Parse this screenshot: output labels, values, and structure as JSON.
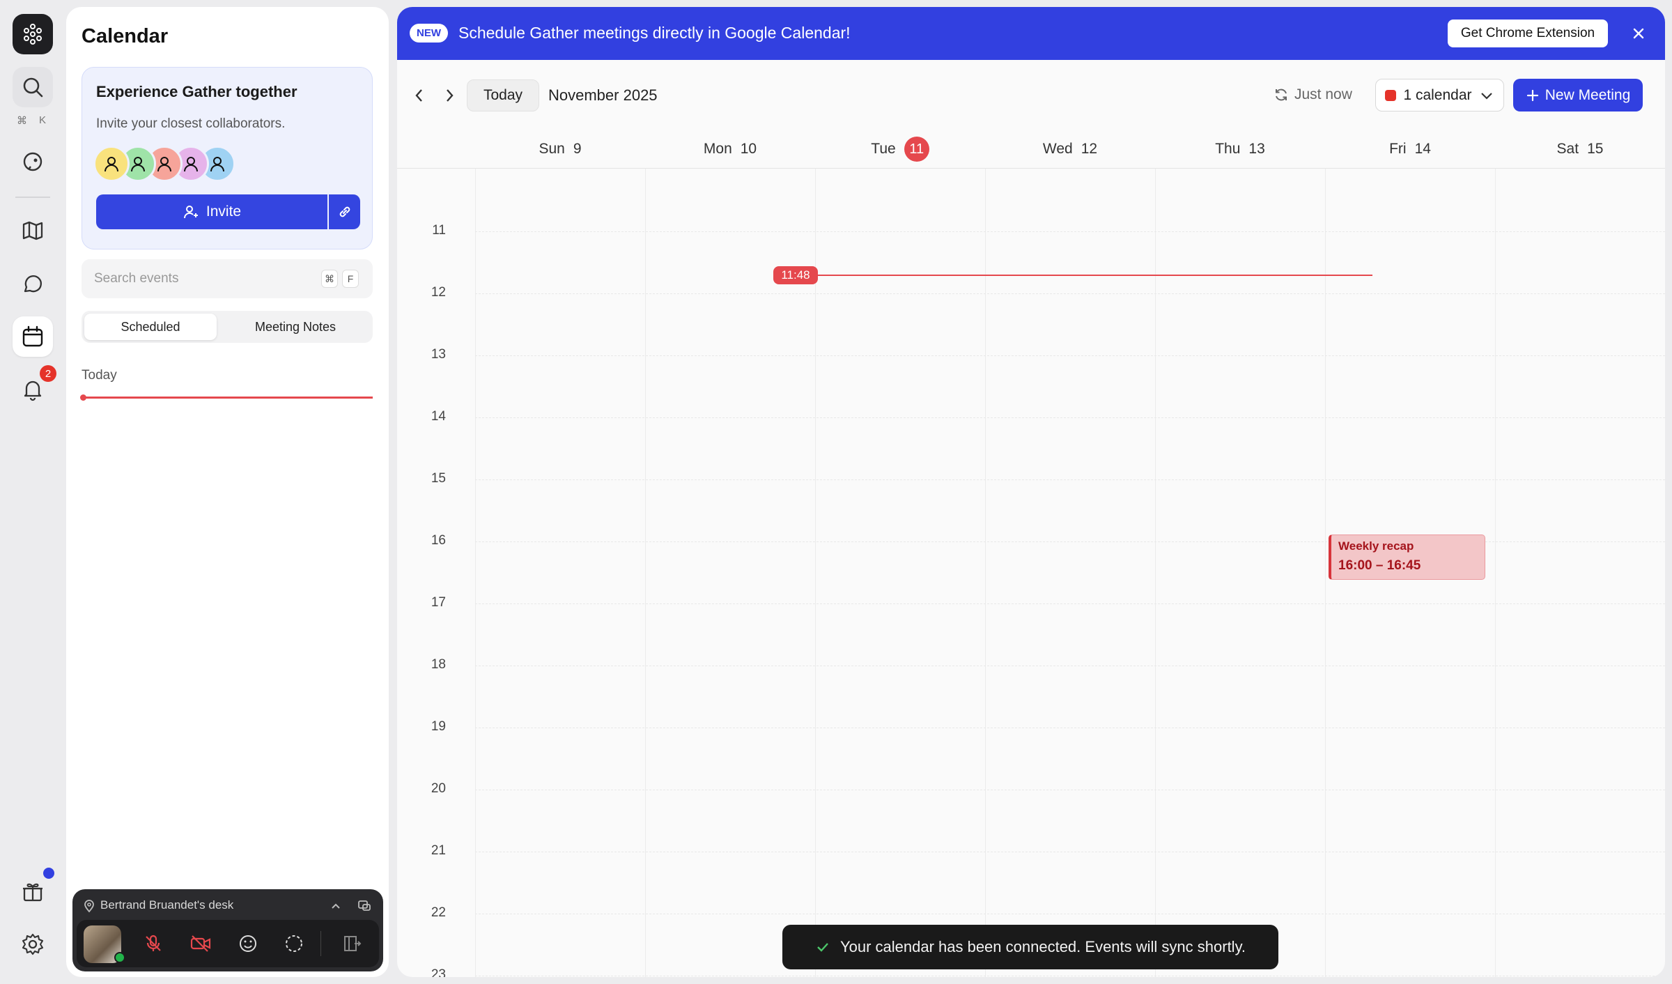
{
  "rail": {
    "shortcut_cmd": "⌘",
    "shortcut_key": "K",
    "notification_count": "2",
    "accent": "#3240e0"
  },
  "sidebar": {
    "title": "Calendar",
    "promo": {
      "title": "Experience Gather together",
      "subtitle": "Invite your closest collaborators.",
      "invite_label": "Invite",
      "avatar_colors": [
        "#f9e27d",
        "#9fe3a8",
        "#f6a49a",
        "#e6b3ea",
        "#9fd2f3"
      ]
    },
    "search": {
      "placeholder": "Search events",
      "kbd_cmd": "⌘",
      "kbd_key": "F"
    },
    "tabs": [
      {
        "label": "Scheduled",
        "active": true
      },
      {
        "label": "Meeting Notes",
        "active": false
      }
    ],
    "today_label": "Today"
  },
  "location": {
    "name": "Bertrand Bruandet's desk"
  },
  "banner": {
    "pill": "NEW",
    "text": "Schedule Gather meetings directly in Google Calendar!",
    "cta": "Get Chrome Extension"
  },
  "toolbar": {
    "today": "Today",
    "month": "November 2025",
    "sync": "Just now",
    "calendar_select": "1 calendar",
    "calendar_color": "#e5332a",
    "new_meeting": "New Meeting"
  },
  "week": {
    "days": [
      {
        "name": "Sun",
        "num": "9",
        "today": false
      },
      {
        "name": "Mon",
        "num": "10",
        "today": false
      },
      {
        "name": "Tue",
        "num": "11",
        "today": true
      },
      {
        "name": "Wed",
        "num": "12",
        "today": false
      },
      {
        "name": "Thu",
        "num": "13",
        "today": false
      },
      {
        "name": "Fri",
        "num": "14",
        "today": false
      },
      {
        "name": "Sat",
        "num": "15",
        "today": false
      }
    ],
    "hours": [
      "11",
      "12",
      "13",
      "14",
      "15",
      "16",
      "17",
      "18",
      "19",
      "20",
      "21",
      "22",
      "23"
    ],
    "now": "11:48"
  },
  "events": [
    {
      "title": "Weekly recap",
      "time": "16:00 – 16:45",
      "day": "Fri"
    }
  ],
  "toast": {
    "text": "Your calendar has been connected. Events will sync shortly."
  }
}
